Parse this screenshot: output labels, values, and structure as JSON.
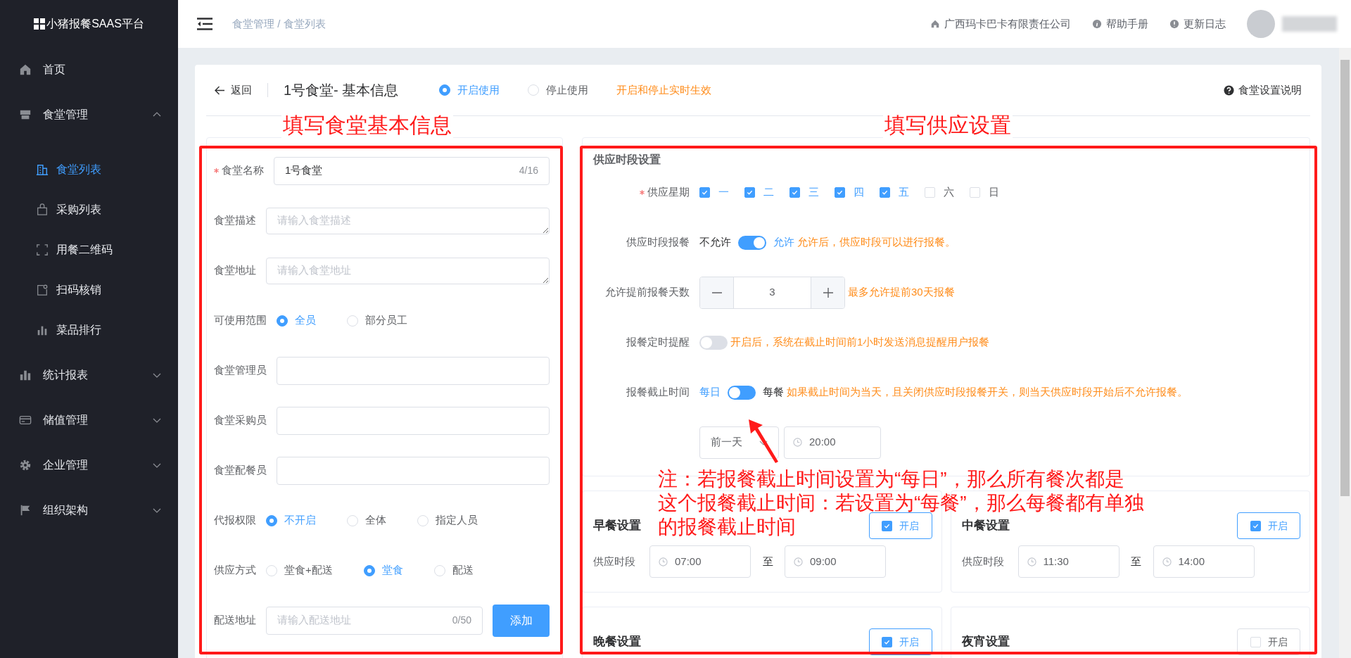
{
  "sidebar": {
    "logo": "小猪报餐SAAS平台",
    "items": [
      {
        "label": "首页",
        "selected": false
      },
      {
        "label": "食堂管理",
        "selected": false,
        "expanded": true,
        "children": [
          {
            "label": "食堂列表",
            "selected": true
          },
          {
            "label": "采购列表",
            "selected": false
          },
          {
            "label": "用餐二维码",
            "selected": false
          },
          {
            "label": "扫码核销",
            "selected": false
          },
          {
            "label": "菜品排行",
            "selected": false
          }
        ]
      },
      {
        "label": "统计报表",
        "selected": false,
        "expanded": false
      },
      {
        "label": "储值管理",
        "selected": false,
        "expanded": false
      },
      {
        "label": "企业管理",
        "selected": false,
        "expanded": false
      },
      {
        "label": "组织架构",
        "selected": false,
        "expanded": false
      }
    ]
  },
  "header": {
    "breadcrumb": "食堂管理 / 食堂列表",
    "links": [
      "广西玛卡巴卡有限责任公司",
      "帮助手册",
      "更新日志"
    ]
  },
  "page": {
    "back": "返回",
    "title": "1号食堂- 基本信息",
    "status_options": [
      {
        "label": "开启使用",
        "selected": true
      },
      {
        "label": "停止使用",
        "selected": false
      }
    ],
    "status_hint": "开启和停止实时生效",
    "help": "食堂设置说明"
  },
  "annotations": {
    "left_title": "填写食堂基本信息",
    "right_title": "填写供应设置",
    "note_lines": [
      "注：若报餐截止时间设置为“每日”，那么所有餐次都是",
      "这个报餐截止时间：若设置为“每餐”，那么每餐都有单独",
      "的报餐截止时间"
    ]
  },
  "basic_form": {
    "fields": [
      {
        "kind": "input",
        "label": "食堂名称",
        "required": true,
        "value": "1号食堂",
        "counter": "4/16"
      },
      {
        "kind": "textarea",
        "label": "食堂描述",
        "required": false,
        "placeholder": "请输入食堂描述"
      },
      {
        "kind": "textarea",
        "label": "食堂地址",
        "required": false,
        "placeholder": "请输入食堂地址"
      },
      {
        "kind": "radio",
        "label": "可使用范围",
        "required": false,
        "options": [
          {
            "label": "全员",
            "selected": true
          },
          {
            "label": "部分员工",
            "selected": false
          }
        ]
      },
      {
        "kind": "input",
        "label": "食堂管理员",
        "required": false
      },
      {
        "kind": "input",
        "label": "食堂采购员",
        "required": false
      },
      {
        "kind": "input",
        "label": "食堂配餐员",
        "required": false
      },
      {
        "kind": "radio",
        "label": "代报权限",
        "required": false,
        "options": [
          {
            "label": "不开启",
            "selected": true
          },
          {
            "label": "全体",
            "selected": false
          },
          {
            "label": "指定人员",
            "selected": false
          }
        ]
      },
      {
        "kind": "radio",
        "label": "供应方式",
        "required": false,
        "options": [
          {
            "label": "堂食+配送",
            "selected": false
          },
          {
            "label": "堂食",
            "selected": true
          },
          {
            "label": "配送",
            "selected": false
          }
        ]
      },
      {
        "kind": "input_button",
        "label": "配送地址",
        "required": false,
        "placeholder": "请输入配送地址",
        "counter": "0/50",
        "button": "添加"
      }
    ]
  },
  "supply": {
    "title": "供应时段设置",
    "rows": [
      {
        "kind": "checkboxes",
        "label": "供应星期",
        "required": true,
        "options": [
          {
            "label": "一",
            "checked": true
          },
          {
            "label": "二",
            "checked": true
          },
          {
            "label": "三",
            "checked": true
          },
          {
            "label": "四",
            "checked": true
          },
          {
            "label": "五",
            "checked": true
          },
          {
            "label": "六",
            "checked": false
          },
          {
            "label": "日",
            "checked": false
          }
        ]
      },
      {
        "kind": "switch",
        "label": "供应时段报餐",
        "required": false,
        "off_label": "不允许",
        "on_label": "允许",
        "on": true,
        "hint": "允许后，供应时段可以进行报餐。"
      },
      {
        "kind": "stepper",
        "label": "允许提前报餐天数",
        "required": false,
        "value": "3",
        "hint": "最多允许提前30天报餐"
      },
      {
        "kind": "switch",
        "label": "报餐定时提醒",
        "required": false,
        "on": false,
        "hint": "开启后，系统在截止时间前1小时发送消息提醒用户报餐"
      },
      {
        "kind": "choice_switch",
        "label": "报餐截止时间",
        "required": false,
        "off_label": "每日",
        "on_label": "每餐",
        "on": false,
        "hint": "如果截止时间为当天，且关闭供应时段报餐开关，则当天供应时段开始后不允许报餐。"
      },
      {
        "kind": "deadline",
        "day": "前一天",
        "time": "20:00"
      }
    ]
  },
  "meals": [
    {
      "title": "早餐设置",
      "toggle": "开启",
      "enabled": true,
      "period_label": "供应时段",
      "start": "07:00",
      "to": "至",
      "end": "09:00"
    },
    {
      "title": "中餐设置",
      "toggle": "开启",
      "enabled": true,
      "period_label": "供应时段",
      "start": "11:30",
      "to": "至",
      "end": "14:00"
    },
    {
      "title": "晚餐设置",
      "toggle": "开启",
      "enabled": true
    },
    {
      "title": "夜宵设置",
      "toggle": "开启",
      "enabled": false
    }
  ]
}
